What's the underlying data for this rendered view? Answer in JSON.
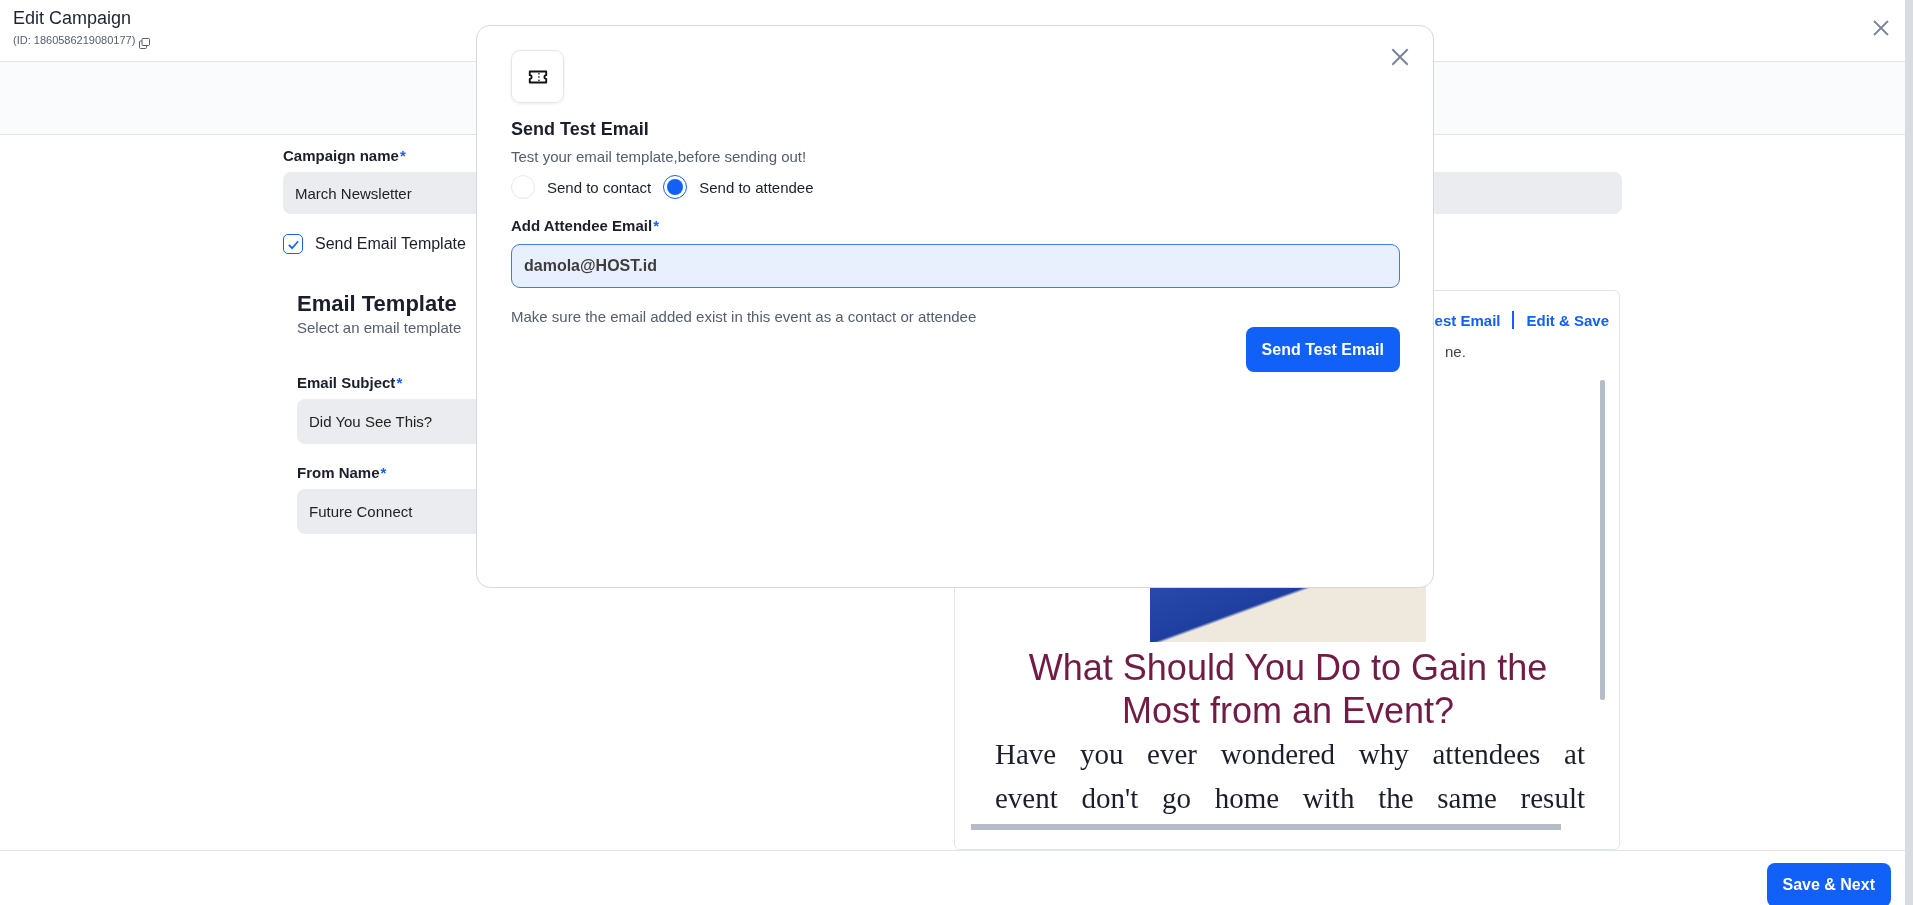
{
  "header": {
    "title": "Edit Campaign",
    "id_label": "(ID: 1860586219080177)"
  },
  "form": {
    "campaign_name": {
      "label": "Campaign name",
      "mark": "*",
      "value": "March Newsletter"
    },
    "send_templates": {
      "label": "Send Email Template",
      "checked": true
    },
    "template_section": {
      "title": "Email Template",
      "subtitle": "Select an email template",
      "fields": [
        {
          "label": "Email Subject",
          "mark": "*",
          "value": "Did You See This?"
        },
        {
          "label": "From Name",
          "mark": "*",
          "value": "Future Connect"
        }
      ]
    }
  },
  "preview": {
    "links": [
      "est Email",
      "Edit & Save"
    ],
    "note": "ne.",
    "headline": "What Should You Do to Gain the Most from an Event?",
    "body_lines": [
      "Have you ever wondered why attendees at",
      "event don't go home with the same result"
    ]
  },
  "footer": {
    "button": "Save & Next"
  },
  "modal": {
    "title": "Send Test Email",
    "subtitle": "Test your email template,before sending out!",
    "options": [
      {
        "label": "Send to contact",
        "selected": false
      },
      {
        "label": "Send to attendee",
        "selected": true
      }
    ],
    "email": {
      "label": "Add Attendee Email",
      "mark": "*",
      "value": "damola@HOST.id"
    },
    "hint": "Make sure the email added exist in this event as a contact or attendee",
    "button": "Send Test Email"
  }
}
